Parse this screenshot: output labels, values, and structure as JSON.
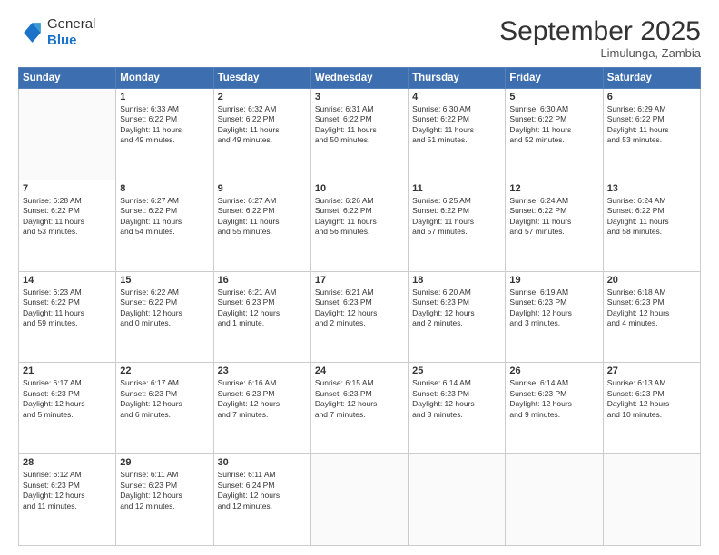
{
  "logo": {
    "general": "General",
    "blue": "Blue"
  },
  "header": {
    "month": "September 2025",
    "location": "Limulunga, Zambia"
  },
  "weekdays": [
    "Sunday",
    "Monday",
    "Tuesday",
    "Wednesday",
    "Thursday",
    "Friday",
    "Saturday"
  ],
  "weeks": [
    [
      {
        "day": "",
        "info": ""
      },
      {
        "day": "1",
        "info": "Sunrise: 6:33 AM\nSunset: 6:22 PM\nDaylight: 11 hours\nand 49 minutes."
      },
      {
        "day": "2",
        "info": "Sunrise: 6:32 AM\nSunset: 6:22 PM\nDaylight: 11 hours\nand 49 minutes."
      },
      {
        "day": "3",
        "info": "Sunrise: 6:31 AM\nSunset: 6:22 PM\nDaylight: 11 hours\nand 50 minutes."
      },
      {
        "day": "4",
        "info": "Sunrise: 6:30 AM\nSunset: 6:22 PM\nDaylight: 11 hours\nand 51 minutes."
      },
      {
        "day": "5",
        "info": "Sunrise: 6:30 AM\nSunset: 6:22 PM\nDaylight: 11 hours\nand 52 minutes."
      },
      {
        "day": "6",
        "info": "Sunrise: 6:29 AM\nSunset: 6:22 PM\nDaylight: 11 hours\nand 53 minutes."
      }
    ],
    [
      {
        "day": "7",
        "info": "Sunrise: 6:28 AM\nSunset: 6:22 PM\nDaylight: 11 hours\nand 53 minutes."
      },
      {
        "day": "8",
        "info": "Sunrise: 6:27 AM\nSunset: 6:22 PM\nDaylight: 11 hours\nand 54 minutes."
      },
      {
        "day": "9",
        "info": "Sunrise: 6:27 AM\nSunset: 6:22 PM\nDaylight: 11 hours\nand 55 minutes."
      },
      {
        "day": "10",
        "info": "Sunrise: 6:26 AM\nSunset: 6:22 PM\nDaylight: 11 hours\nand 56 minutes."
      },
      {
        "day": "11",
        "info": "Sunrise: 6:25 AM\nSunset: 6:22 PM\nDaylight: 11 hours\nand 57 minutes."
      },
      {
        "day": "12",
        "info": "Sunrise: 6:24 AM\nSunset: 6:22 PM\nDaylight: 11 hours\nand 57 minutes."
      },
      {
        "day": "13",
        "info": "Sunrise: 6:24 AM\nSunset: 6:22 PM\nDaylight: 11 hours\nand 58 minutes."
      }
    ],
    [
      {
        "day": "14",
        "info": "Sunrise: 6:23 AM\nSunset: 6:22 PM\nDaylight: 11 hours\nand 59 minutes."
      },
      {
        "day": "15",
        "info": "Sunrise: 6:22 AM\nSunset: 6:22 PM\nDaylight: 12 hours\nand 0 minutes."
      },
      {
        "day": "16",
        "info": "Sunrise: 6:21 AM\nSunset: 6:23 PM\nDaylight: 12 hours\nand 1 minute."
      },
      {
        "day": "17",
        "info": "Sunrise: 6:21 AM\nSunset: 6:23 PM\nDaylight: 12 hours\nand 2 minutes."
      },
      {
        "day": "18",
        "info": "Sunrise: 6:20 AM\nSunset: 6:23 PM\nDaylight: 12 hours\nand 2 minutes."
      },
      {
        "day": "19",
        "info": "Sunrise: 6:19 AM\nSunset: 6:23 PM\nDaylight: 12 hours\nand 3 minutes."
      },
      {
        "day": "20",
        "info": "Sunrise: 6:18 AM\nSunset: 6:23 PM\nDaylight: 12 hours\nand 4 minutes."
      }
    ],
    [
      {
        "day": "21",
        "info": "Sunrise: 6:17 AM\nSunset: 6:23 PM\nDaylight: 12 hours\nand 5 minutes."
      },
      {
        "day": "22",
        "info": "Sunrise: 6:17 AM\nSunset: 6:23 PM\nDaylight: 12 hours\nand 6 minutes."
      },
      {
        "day": "23",
        "info": "Sunrise: 6:16 AM\nSunset: 6:23 PM\nDaylight: 12 hours\nand 7 minutes."
      },
      {
        "day": "24",
        "info": "Sunrise: 6:15 AM\nSunset: 6:23 PM\nDaylight: 12 hours\nand 7 minutes."
      },
      {
        "day": "25",
        "info": "Sunrise: 6:14 AM\nSunset: 6:23 PM\nDaylight: 12 hours\nand 8 minutes."
      },
      {
        "day": "26",
        "info": "Sunrise: 6:14 AM\nSunset: 6:23 PM\nDaylight: 12 hours\nand 9 minutes."
      },
      {
        "day": "27",
        "info": "Sunrise: 6:13 AM\nSunset: 6:23 PM\nDaylight: 12 hours\nand 10 minutes."
      }
    ],
    [
      {
        "day": "28",
        "info": "Sunrise: 6:12 AM\nSunset: 6:23 PM\nDaylight: 12 hours\nand 11 minutes."
      },
      {
        "day": "29",
        "info": "Sunrise: 6:11 AM\nSunset: 6:23 PM\nDaylight: 12 hours\nand 12 minutes."
      },
      {
        "day": "30",
        "info": "Sunrise: 6:11 AM\nSunset: 6:24 PM\nDaylight: 12 hours\nand 12 minutes."
      },
      {
        "day": "",
        "info": ""
      },
      {
        "day": "",
        "info": ""
      },
      {
        "day": "",
        "info": ""
      },
      {
        "day": "",
        "info": ""
      }
    ]
  ]
}
